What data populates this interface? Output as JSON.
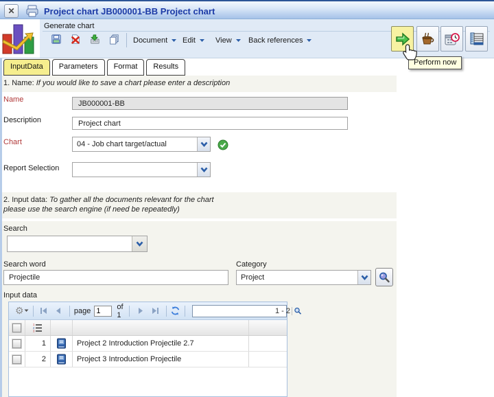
{
  "titlebar": {
    "title": "Project chart JB000001-BB Project chart"
  },
  "toolbar": {
    "group_label": "Generate chart",
    "menus": {
      "document": "Document",
      "edit": "Edit",
      "view": "View",
      "back_references": "Back references"
    },
    "tooltip": "Perform now"
  },
  "tabs": {
    "input_data": "InputData",
    "parameters": "Parameters",
    "format": "Format",
    "results": "Results"
  },
  "sections": {
    "name": {
      "prefix": "1. Name: ",
      "note": "If you would like to save a chart please enter a description"
    },
    "input_data": {
      "prefix": "2. Input data: ",
      "note1": "To gather all the documents relevant for the chart",
      "note2": "please use the search engine (if need be repeatedly)"
    }
  },
  "form": {
    "name_label": "Name",
    "name_value": "JB000001-BB",
    "description_label": "Description",
    "description_value": "Project chart",
    "chart_label": "Chart",
    "chart_value": "04 - Job chart target/actual",
    "report_selection_label": "Report Selection",
    "report_selection_value": ""
  },
  "search": {
    "label": "Search",
    "value": "",
    "word_label": "Search word",
    "word_value": "Projectile",
    "category_label": "Category",
    "category_value": "Project"
  },
  "grid": {
    "label": "Input data",
    "pager": {
      "page_label": "page",
      "page_value": "1",
      "of_label": "of 1",
      "range_value": "1 - 2"
    },
    "rows": [
      {
        "num": "1",
        "title": "Project 2 Introduction Projectile 2.7"
      },
      {
        "num": "2",
        "title": "Project 3 Introduction Projectile"
      }
    ]
  },
  "colors": {
    "title_text": "#1b3aa6",
    "tab_active_bg": "#f6ee8e",
    "required_label": "#b03838",
    "band_beige": "#f4f4ee",
    "tooltip_bg": "#ffffe1",
    "perform_hover_bg": "#f7f2a2",
    "perform_arrow_green": "#3fbf3f"
  }
}
